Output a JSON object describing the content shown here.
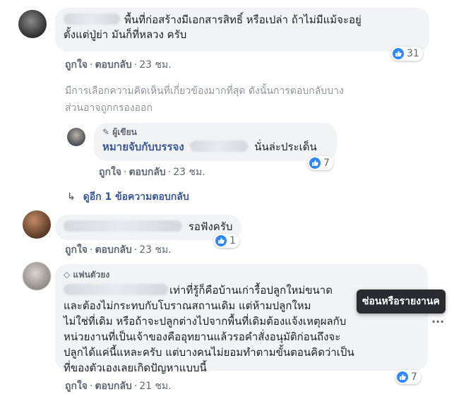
{
  "comment1": {
    "line1": "พื้นที่ก่อสร้างมีเอกสารสิทธิ์ หรือเปล่า ถ้าไม่มีแม้จะอยู่",
    "line2": "ตั้งแต่ปู่ย่า มันก็ที่หลวง ครับ",
    "like": "ถูกใจ",
    "reply": "ตอบกลับ",
    "time": "23 ชม.",
    "reactions": "31"
  },
  "filter_notice": {
    "line1": "มีการเลือกความคิดเห็นที่เกี่ยวข้องมากที่สุด ดังนั้นการตอบกลับบาง",
    "line2": "ส่วนอาจถูกกรองออก"
  },
  "reply1": {
    "badge": "ผู้เขียน",
    "author": "หมายจับกับบรรจง",
    "text": "นั่นล่ะประเด็น",
    "like": "ถูกใจ",
    "reply": "ตอบกลับ",
    "time": "23 ชม.",
    "reactions": "7"
  },
  "more_replies": "ดูอีก 1 ข้อความตอบกลับ",
  "comment2": {
    "text": "รอฟังครับ",
    "like": "ถูกใจ",
    "reply": "ตอบกลับ",
    "time": "23 ชม.",
    "reactions": "1"
  },
  "comment3": {
    "badge": "แฟนตัวยง",
    "line1": "เท่าที่รู้ก็คือบ้านเก่ารื้อปลูกใหม่ขนาด",
    "line2": "และต้องไม่กระทบกับโบราณสถานเดิม แต่ห้ามปลูกใหม",
    "line3": "ไม่ใช่ที่เดิม หรือถ้าจะปลูกต่างไปจากพื้นที่เดิมต้องแจ้งเหตุผลกับ",
    "line4": "หน่วยงานที่เป็นเจ้าของคืออุทยานแล้วรอคำสั่งอนุมัติก่อนถึงจะ",
    "line5": "ปลูกได้แค่นี้แหละครับ แต่บางคนไม่ยอมทำตามขั้นตอนคิดว่าเป็น",
    "line6": "ที่ของตัวเองเลยเกิดปัญหาแบบนี้",
    "like": "ถูกใจ",
    "reply": "ตอบกลับ",
    "time": "21 ชม.",
    "reactions": "7"
  },
  "tooltip": "ซ่อนหรือรายงานค",
  "more_options": "···",
  "colors": {
    "bubble": "#f2f3f5",
    "link": "#385898",
    "like_blue": "#2d88ff",
    "meta": "#606770"
  }
}
